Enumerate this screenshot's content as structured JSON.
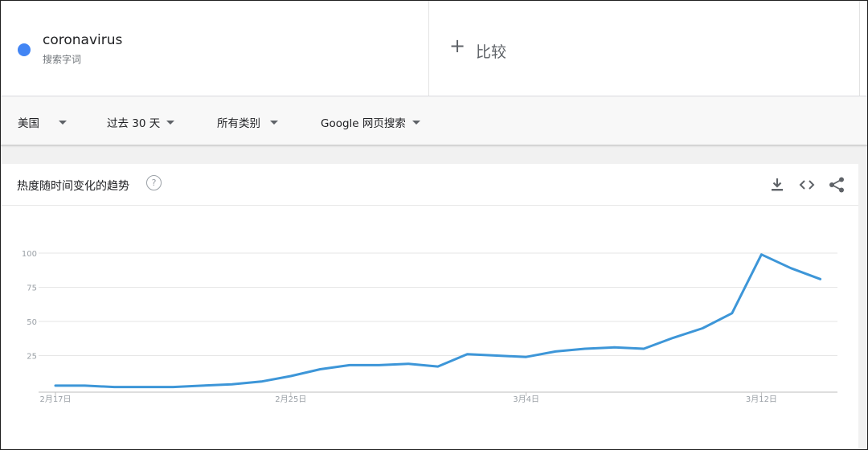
{
  "search_term": {
    "name": "coronavirus",
    "subtitle": "搜索字词",
    "color": "#4285f4"
  },
  "compare": {
    "plus": "+",
    "label": "比较"
  },
  "filters": {
    "region": "美国",
    "time_range": "过去 30 天",
    "category": "所有类别",
    "search_type": "Google 网页搜索"
  },
  "card": {
    "title": "热度随时间变化的趋势",
    "help": "?",
    "tools": [
      "download-icon",
      "embed-icon",
      "share-icon"
    ]
  },
  "chart_data": {
    "type": "line",
    "title": "",
    "xlabel": "",
    "ylabel": "",
    "ylim": [
      0,
      100
    ],
    "yticks": [
      25,
      50,
      75,
      100
    ],
    "x_tick_labels": [
      {
        "label": "2月17日",
        "index": 0
      },
      {
        "label": "2月25日",
        "index": 8
      },
      {
        "label": "3月4日",
        "index": 16
      },
      {
        "label": "3月12日",
        "index": 24
      }
    ],
    "x": [
      "2月17日",
      "2月18日",
      "2月19日",
      "2月20日",
      "2月21日",
      "2月22日",
      "2月23日",
      "2月24日",
      "2月25日",
      "2月26日",
      "2月27日",
      "2月28日",
      "2月29日",
      "3月1日",
      "3月2日",
      "3月3日",
      "3月4日",
      "3月5日",
      "3月6日",
      "3月7日",
      "3月8日",
      "3月9日",
      "3月10日",
      "3月11日",
      "3月12日",
      "3月13日",
      "3月14日"
    ],
    "series": [
      {
        "name": "coronavirus",
        "color": "#3d96d8",
        "values": [
          3,
          3,
          2,
          2,
          2,
          3,
          4,
          6,
          10,
          15,
          18,
          18,
          19,
          17,
          26,
          25,
          24,
          28,
          30,
          31,
          30,
          38,
          45,
          56,
          99,
          89,
          81
        ]
      }
    ],
    "grid": true,
    "legend": "none"
  }
}
